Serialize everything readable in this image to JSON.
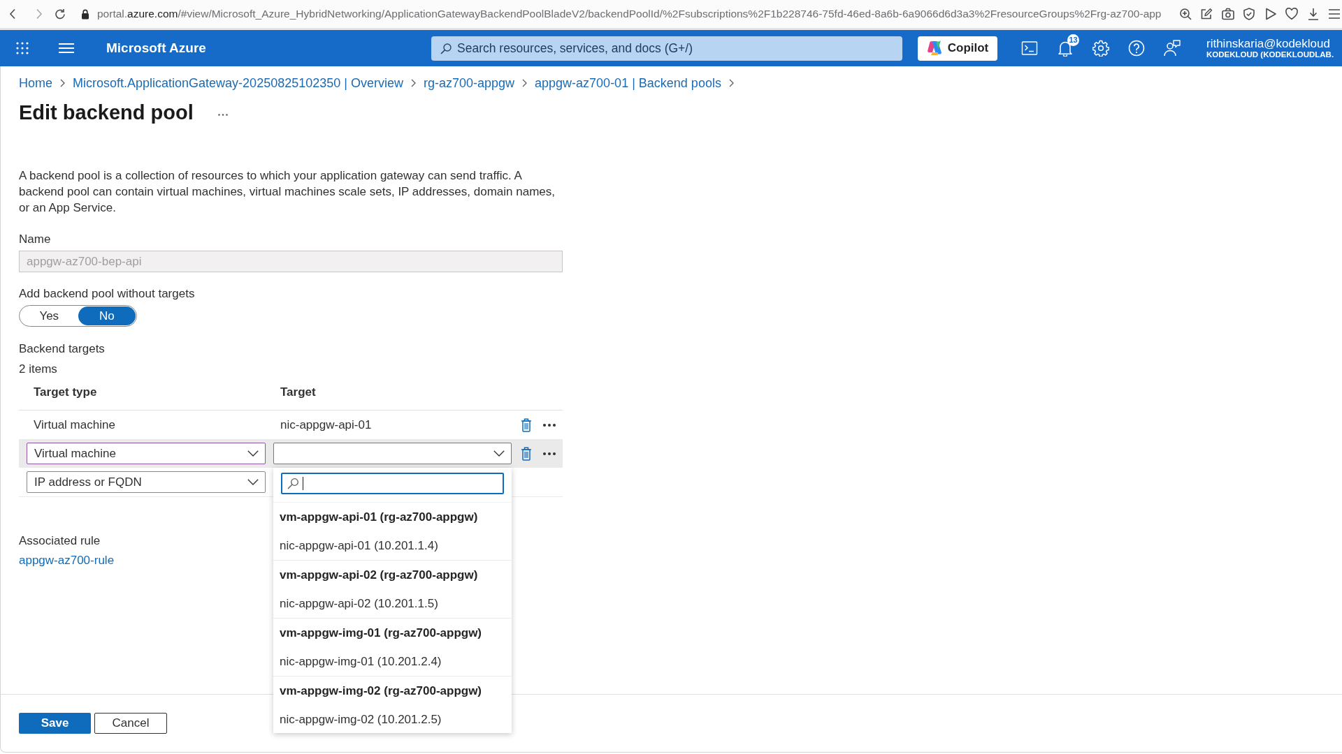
{
  "browser": {
    "forward_disabled": true,
    "url": {
      "subdomain": "portal.",
      "domain": "azure.com",
      "path": "/#view/Microsoft_Azure_HybridNetworking/ApplicationGatewayBackendPoolBladeV2/backendPoolId/%2Fsubscriptions%2F1b228746-75fd-46ed-8a6b-6a9066d6d3a3%2FresourceGroups%2Frg-az700-app"
    }
  },
  "header": {
    "brand": "Microsoft Azure",
    "search": {
      "placeholder": "Search resources, services, and docs (G+/)"
    },
    "copilot": "Copilot",
    "notification_count": "13",
    "account": {
      "email": "rithinskaria@kodekloud",
      "directory": "KODEKLOUD (KODEKLOUDLAB."
    }
  },
  "breadcrumb": [
    "Home",
    "Microsoft.ApplicationGateway-20250825102350 | Overview",
    "rg-az700-appgw",
    "appgw-az700-01 | Backend pools"
  ],
  "title": "Edit backend pool",
  "description": "A backend pool is a collection of resources to which your application gateway can send traffic. A backend pool can contain virtual machines, virtual machines scale sets, IP addresses, domain names, or an App Service.",
  "name_field": {
    "label": "Name",
    "value": "appgw-az700-bep-api",
    "disabled": true
  },
  "without_targets": {
    "label": "Add backend pool without targets",
    "options": [
      {
        "label": "Yes",
        "selected": false
      },
      {
        "label": "No",
        "selected": true
      }
    ]
  },
  "backend_targets": {
    "title": "Backend targets",
    "count": "2 items",
    "columns": [
      "Target type",
      "Target"
    ],
    "rows": [
      {
        "kind": "static",
        "target_type": "Virtual machine",
        "target": "nic-appgw-api-01"
      },
      {
        "kind": "editing",
        "target_type": "Virtual machine",
        "type_focused": true,
        "target_expanded": true,
        "target_menu": {
          "groups": [
            {
              "resource": "vm-appgw-api-01 (rg-az700-appgw)",
              "option": "nic-appgw-api-01 (10.201.1.4)"
            },
            {
              "resource": "vm-appgw-api-02 (rg-az700-appgw)",
              "option": "nic-appgw-api-02 (10.201.1.5)"
            },
            {
              "resource": "vm-appgw-img-01 (rg-az700-appgw)",
              "option": "nic-appgw-img-01 (10.201.2.4)"
            },
            {
              "resource": "vm-appgw-img-02 (rg-az700-appgw)",
              "option": "nic-appgw-img-02 (10.201.2.5)"
            }
          ]
        }
      },
      {
        "kind": "new",
        "target_type": "IP address or FQDN",
        "type_focused": false
      }
    ]
  },
  "associated_rule": {
    "label": "Associated rule",
    "link": "appgw-az700-rule"
  },
  "actions": [
    {
      "label": "Save",
      "kind": "primary"
    },
    {
      "label": "Cancel",
      "kind": "secondary"
    }
  ]
}
